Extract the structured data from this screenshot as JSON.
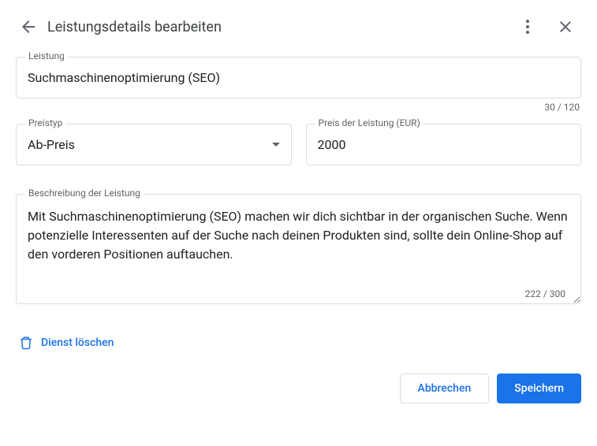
{
  "header": {
    "title": "Leistungsdetails bearbeiten"
  },
  "service_name": {
    "label": "Leistung",
    "value": "Suchmaschinenoptimierung (SEO)",
    "counter": "30 / 120"
  },
  "price_type": {
    "label": "Preistyp",
    "value": "Ab-Preis"
  },
  "price": {
    "label": "Preis der Leistung (EUR)",
    "value": "2000"
  },
  "description": {
    "label": "Beschreibung der Leistung",
    "value": "Mit Suchmaschinenoptimierung (SEO) machen wir dich sichtbar in der organischen Suche. Wenn potenzielle Interessenten auf der Suche nach deinen Produkten sind, sollte dein Online-Shop auf den vorderen Positionen auftauchen.",
    "counter": "222 / 300"
  },
  "actions": {
    "delete": "Dienst löschen",
    "cancel": "Abbrechen",
    "save": "Speichern"
  }
}
